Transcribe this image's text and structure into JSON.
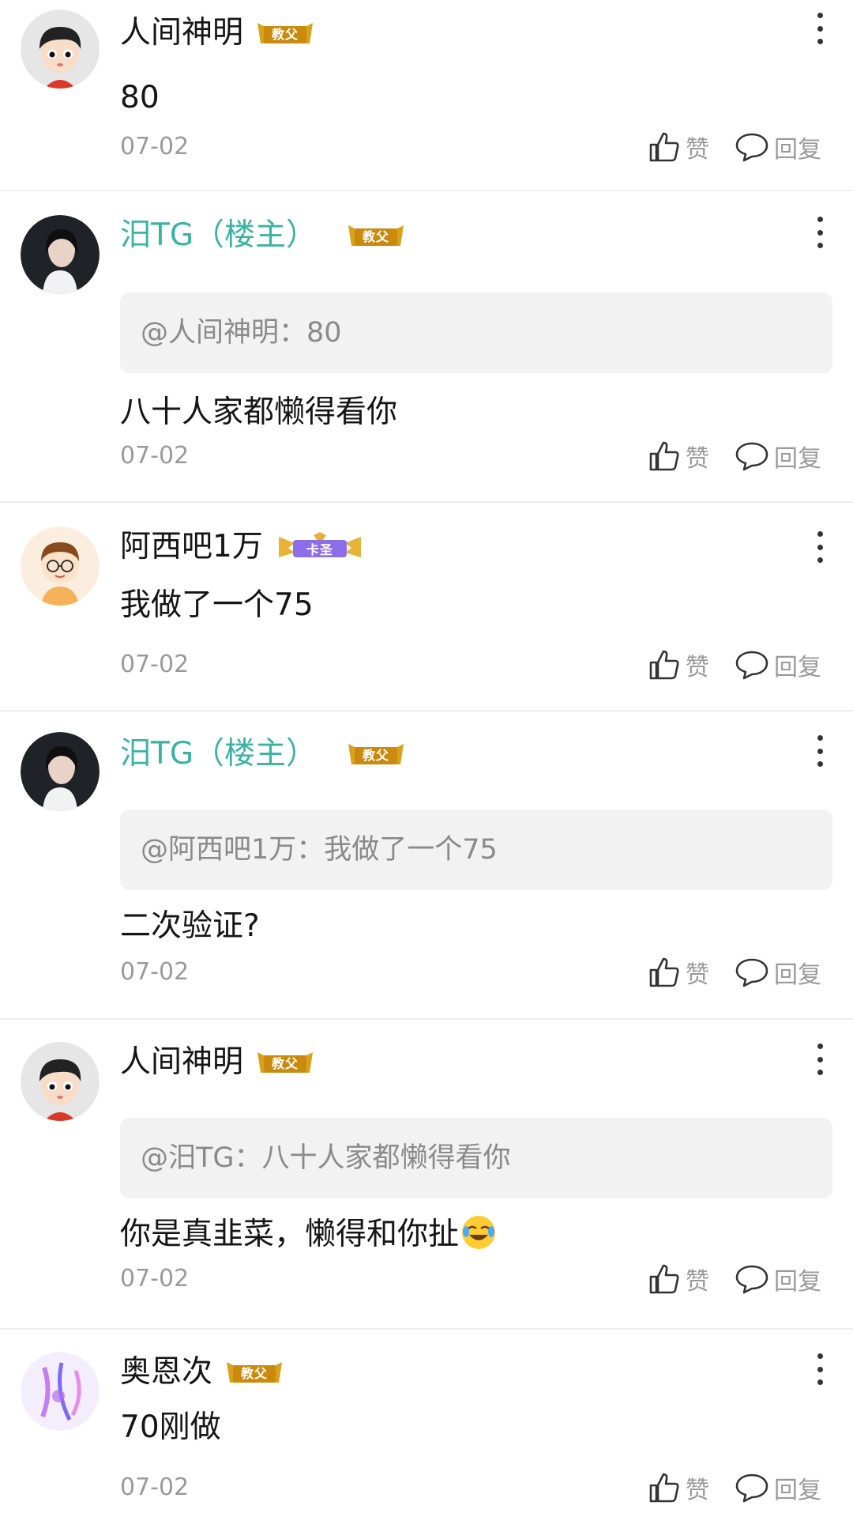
{
  "comments": [
    {
      "username": "人间神明",
      "badge": "教父",
      "is_op": false,
      "avatar": "cartoon-boy-avatar",
      "quote": null,
      "content": "80",
      "date": "07-02",
      "like_label": "赞",
      "reply_label": "回复"
    },
    {
      "username": "汨TG（楼主）",
      "badge": "教父",
      "is_op": true,
      "avatar": "portrait-photo-avatar",
      "quote": "@人间神明：80",
      "content": "八十人家都懒得看你",
      "date": "07-02",
      "like_label": "赞",
      "reply_label": "回复"
    },
    {
      "username": "阿西吧1万",
      "badge": "卡圣",
      "is_op": false,
      "avatar": "glasses-cartoon-avatar",
      "quote": null,
      "content": "我做了一个75",
      "date": "07-02",
      "like_label": "赞",
      "reply_label": "回复"
    },
    {
      "username": "汨TG（楼主）",
      "badge": "教父",
      "is_op": true,
      "avatar": "portrait-photo-avatar",
      "quote": "@阿西吧1万：我做了一个75",
      "content": "二次验证?",
      "date": "07-02",
      "like_label": "赞",
      "reply_label": "回复"
    },
    {
      "username": "人间神明",
      "badge": "教父",
      "is_op": false,
      "avatar": "cartoon-boy-avatar",
      "quote": "@汨TG：八十人家都懒得看你",
      "content": "你是真韭菜，懒得和你扯",
      "content_emoji": "laughing-crying-emoji",
      "date": "07-02",
      "like_label": "赞",
      "reply_label": "回复"
    },
    {
      "username": "奥恩次",
      "badge": "教父",
      "is_op": false,
      "avatar": "purple-light-avatar",
      "quote": null,
      "content": "70刚做",
      "date": "07-02",
      "like_label": "赞",
      "reply_label": "回复"
    }
  ],
  "colors": {
    "op_name": "#3bb3a2",
    "text": "#151515",
    "meta": "#9a9a9a",
    "quote_bg": "#f2f2f2",
    "badge_gold": "#d9a21a",
    "badge_purple": "#8b6ee8"
  }
}
